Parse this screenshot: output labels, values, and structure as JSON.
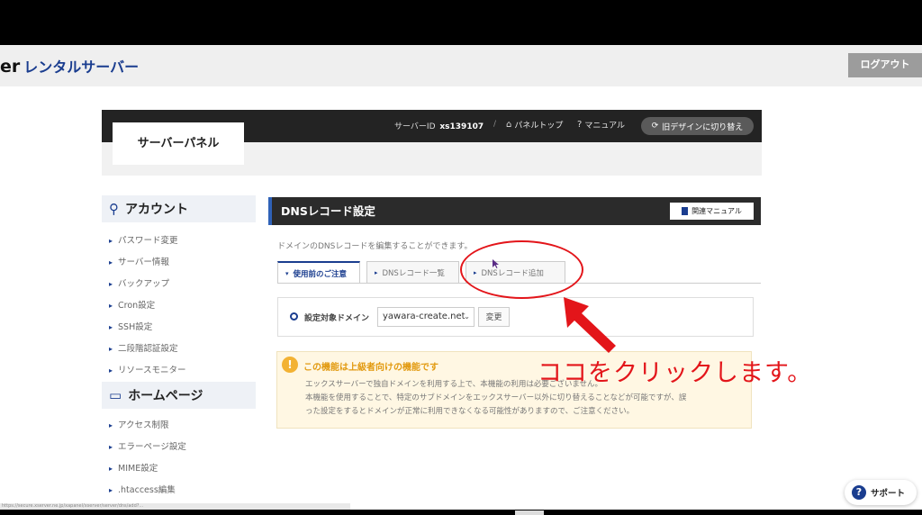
{
  "header": {
    "brand_prefix": "er",
    "brand_sub": "レンタルサーバー",
    "logout_label": "ログアウト"
  },
  "panel": {
    "title": "サーバーパネル",
    "server_id_label": "サーバーID",
    "server_id_value": "xs139107",
    "separator": "/",
    "panel_top_label": "パネルトップ",
    "manual_label": "マニュアル",
    "redesign_label": "旧デザインに切り替え"
  },
  "sidebar": {
    "account_heading": "アカウント",
    "account_items": [
      "パスワード変更",
      "サーバー情報",
      "バックアップ",
      "Cron設定",
      "SSH設定",
      "二段階認証設定",
      "リソースモニター"
    ],
    "homepage_heading": "ホームページ",
    "homepage_items": [
      "アクセス制限",
      "エラーページ設定",
      "MIME設定",
      ".htaccess編集"
    ]
  },
  "main": {
    "section_title": "DNSレコード設定",
    "related_manual_label": "関連マニュアル",
    "description": "ドメインのDNSレコードを編集することができます。",
    "tabs": [
      {
        "label": "使用前のご注意",
        "active": true
      },
      {
        "label": "DNSレコード一覧",
        "active": false
      },
      {
        "label": "DNSレコード追加",
        "active": false
      }
    ],
    "domain_label": "設定対象ドメイン",
    "domain_value": "yawara-create.net",
    "change_label": "変更",
    "notice_title": "この機能は上級者向けの機能です",
    "notice_body_1": "エックスサーバーで独自ドメインを利用する上で、本機能の利用は必要ございません。",
    "notice_body_2": "本機能を使用することで、特定のサブドメインをエックスサーバー以外に切り替えることなどが可能ですが、誤",
    "notice_body_3": "った設定をするとドメインが正常に利用できなくなる可能性がありますので、ご注意ください。"
  },
  "annotation": {
    "callout_text": "ココをクリックします。",
    "color": "#e3151a"
  },
  "support": {
    "label": "サポート"
  },
  "statusbar": {
    "url": "https://secure.xserver.ne.jp/xapanel/xserver/server/dns/add?..."
  },
  "colors": {
    "accent": "#1a3d8f",
    "panel_dark": "#232323",
    "notice_bg": "#fff7e3",
    "notice_title": "#e29a10"
  }
}
